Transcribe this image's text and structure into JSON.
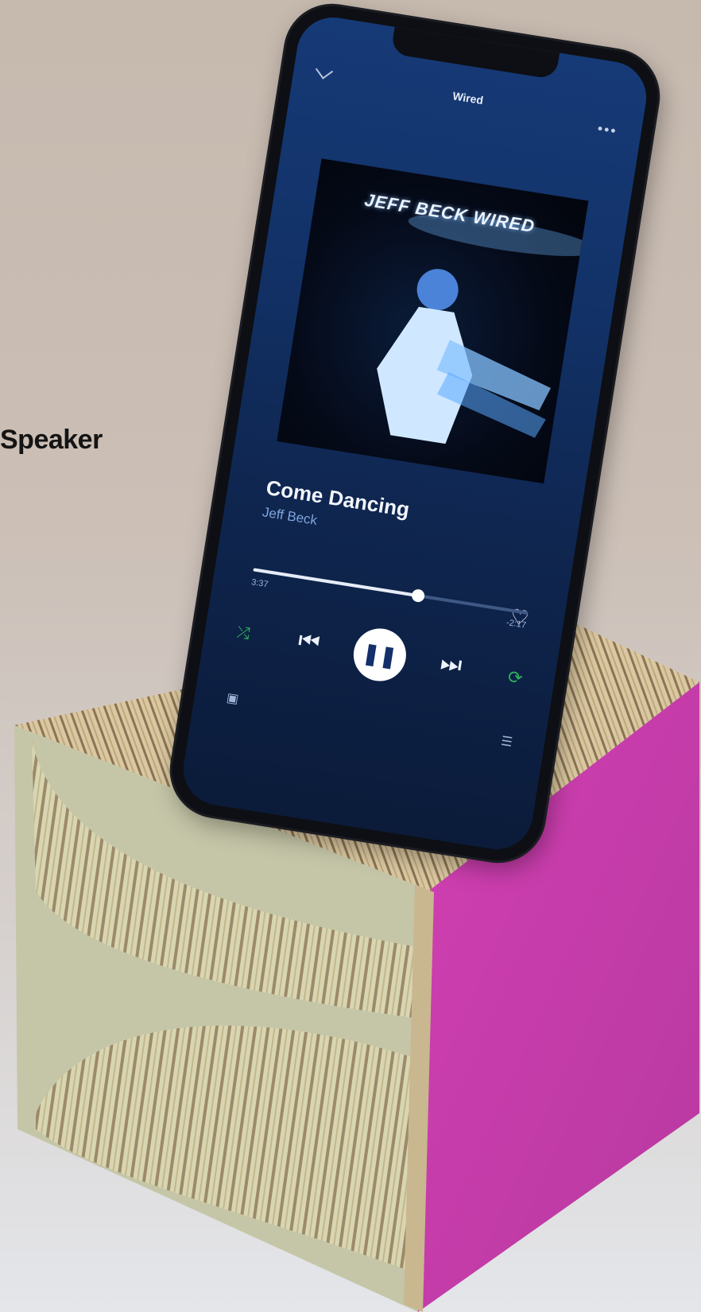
{
  "caption": {
    "text": "Speaker"
  },
  "player": {
    "context_title": "Wired",
    "more_icon": "more-icon",
    "collapse_icon": "chevron-down-icon",
    "album_cover_text": "JEFF BECK WIRED",
    "track_title": "Come Dancing",
    "artist": "Jeff Beck",
    "elapsed": "3:37",
    "remaining": "-2:17",
    "progress": 0.6,
    "controls": {
      "shuffle_icon": "shuffle-icon",
      "prev_icon": "skip-previous-icon",
      "play_icon": "pause-icon",
      "next_icon": "skip-next-icon",
      "repeat_icon": "repeat-icon",
      "heart_icon": "heart-icon",
      "devices_icon": "devices-icon",
      "queue_icon": "queue-icon"
    },
    "colors": {
      "accent": "#2fb15a",
      "background": "#123268"
    }
  },
  "speaker": {
    "side_color": "#c63faf",
    "wood_color": "#c7b88f"
  }
}
